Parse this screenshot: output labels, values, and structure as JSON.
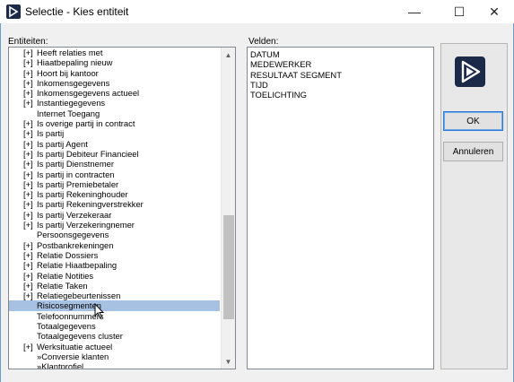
{
  "window": {
    "title": "Selectie - Kies entiteit",
    "minimize_glyph": "—",
    "maximize_glyph": "☐",
    "close_glyph": "✕",
    "icon": "app-logo-icon"
  },
  "entities": {
    "label": "Entiteiten:",
    "selected_item": "Risicosegmenten",
    "items": [
      {
        "exp": "[+]",
        "label": "Heeft relaties met"
      },
      {
        "exp": "[+]",
        "label": "Hiaatbepaling nieuw"
      },
      {
        "exp": "[+]",
        "label": "Hoort bij kantoor"
      },
      {
        "exp": "[+]",
        "label": "Inkomensgegevens"
      },
      {
        "exp": "[+]",
        "label": "Inkomensgegevens actueel"
      },
      {
        "exp": "[+]",
        "label": "Instantiegegevens"
      },
      {
        "exp": "",
        "label": "Internet Toegang"
      },
      {
        "exp": "[+]",
        "label": "Is overige partij in contract"
      },
      {
        "exp": "[+]",
        "label": "Is partij"
      },
      {
        "exp": "[+]",
        "label": "Is partij Agent"
      },
      {
        "exp": "[+]",
        "label": "Is partij Debiteur Financieel"
      },
      {
        "exp": "[+]",
        "label": "Is partij Dienstnemer"
      },
      {
        "exp": "[+]",
        "label": "Is partij in contracten"
      },
      {
        "exp": "[+]",
        "label": "Is partij Premiebetaler"
      },
      {
        "exp": "[+]",
        "label": "Is partij Rekeninghouder"
      },
      {
        "exp": "[+]",
        "label": "Is partij Rekeningverstrekker"
      },
      {
        "exp": "[+]",
        "label": "Is partij Verzekeraar"
      },
      {
        "exp": "[+]",
        "label": "Is partij Verzekeringnemer"
      },
      {
        "exp": "",
        "label": "Persoonsgegevens"
      },
      {
        "exp": "[+]",
        "label": "Postbankrekeningen"
      },
      {
        "exp": "[+]",
        "label": "Relatie Dossiers"
      },
      {
        "exp": "[+]",
        "label": "Relatie Hiaatbepaling"
      },
      {
        "exp": "[+]",
        "label": "Relatie Notities"
      },
      {
        "exp": "[+]",
        "label": "Relatie Taken"
      },
      {
        "exp": "[+]",
        "label": "Relatiegebeurtenissen"
      },
      {
        "exp": "",
        "label": "Risicosegmenten"
      },
      {
        "exp": "",
        "label": "Telefoonnummers"
      },
      {
        "exp": "",
        "label": "Totaalgegevens"
      },
      {
        "exp": "",
        "label": "Totaalgegevens cluster"
      },
      {
        "exp": "[+]",
        "label": "Werksituatie actueel"
      },
      {
        "exp": "",
        "label": "»Conversie klanten"
      },
      {
        "exp": "",
        "label": "»Klantprofiel"
      }
    ],
    "scroll_up_glyph": "▲",
    "scroll_down_glyph": "▼"
  },
  "fields": {
    "label": "Velden:",
    "items": [
      "DATUM",
      "MEDEWERKER",
      "RESULTAAT SEGMENT",
      "TIJD",
      "TOELICHTING"
    ]
  },
  "buttons": {
    "ok_label": "OK",
    "cancel_label": "Annuleren"
  },
  "colors": {
    "selection": "#a7c1e3",
    "default_button_border": "#2e7bd6",
    "logo": "#1c2a4a",
    "window_border": "#6e9bd0"
  }
}
